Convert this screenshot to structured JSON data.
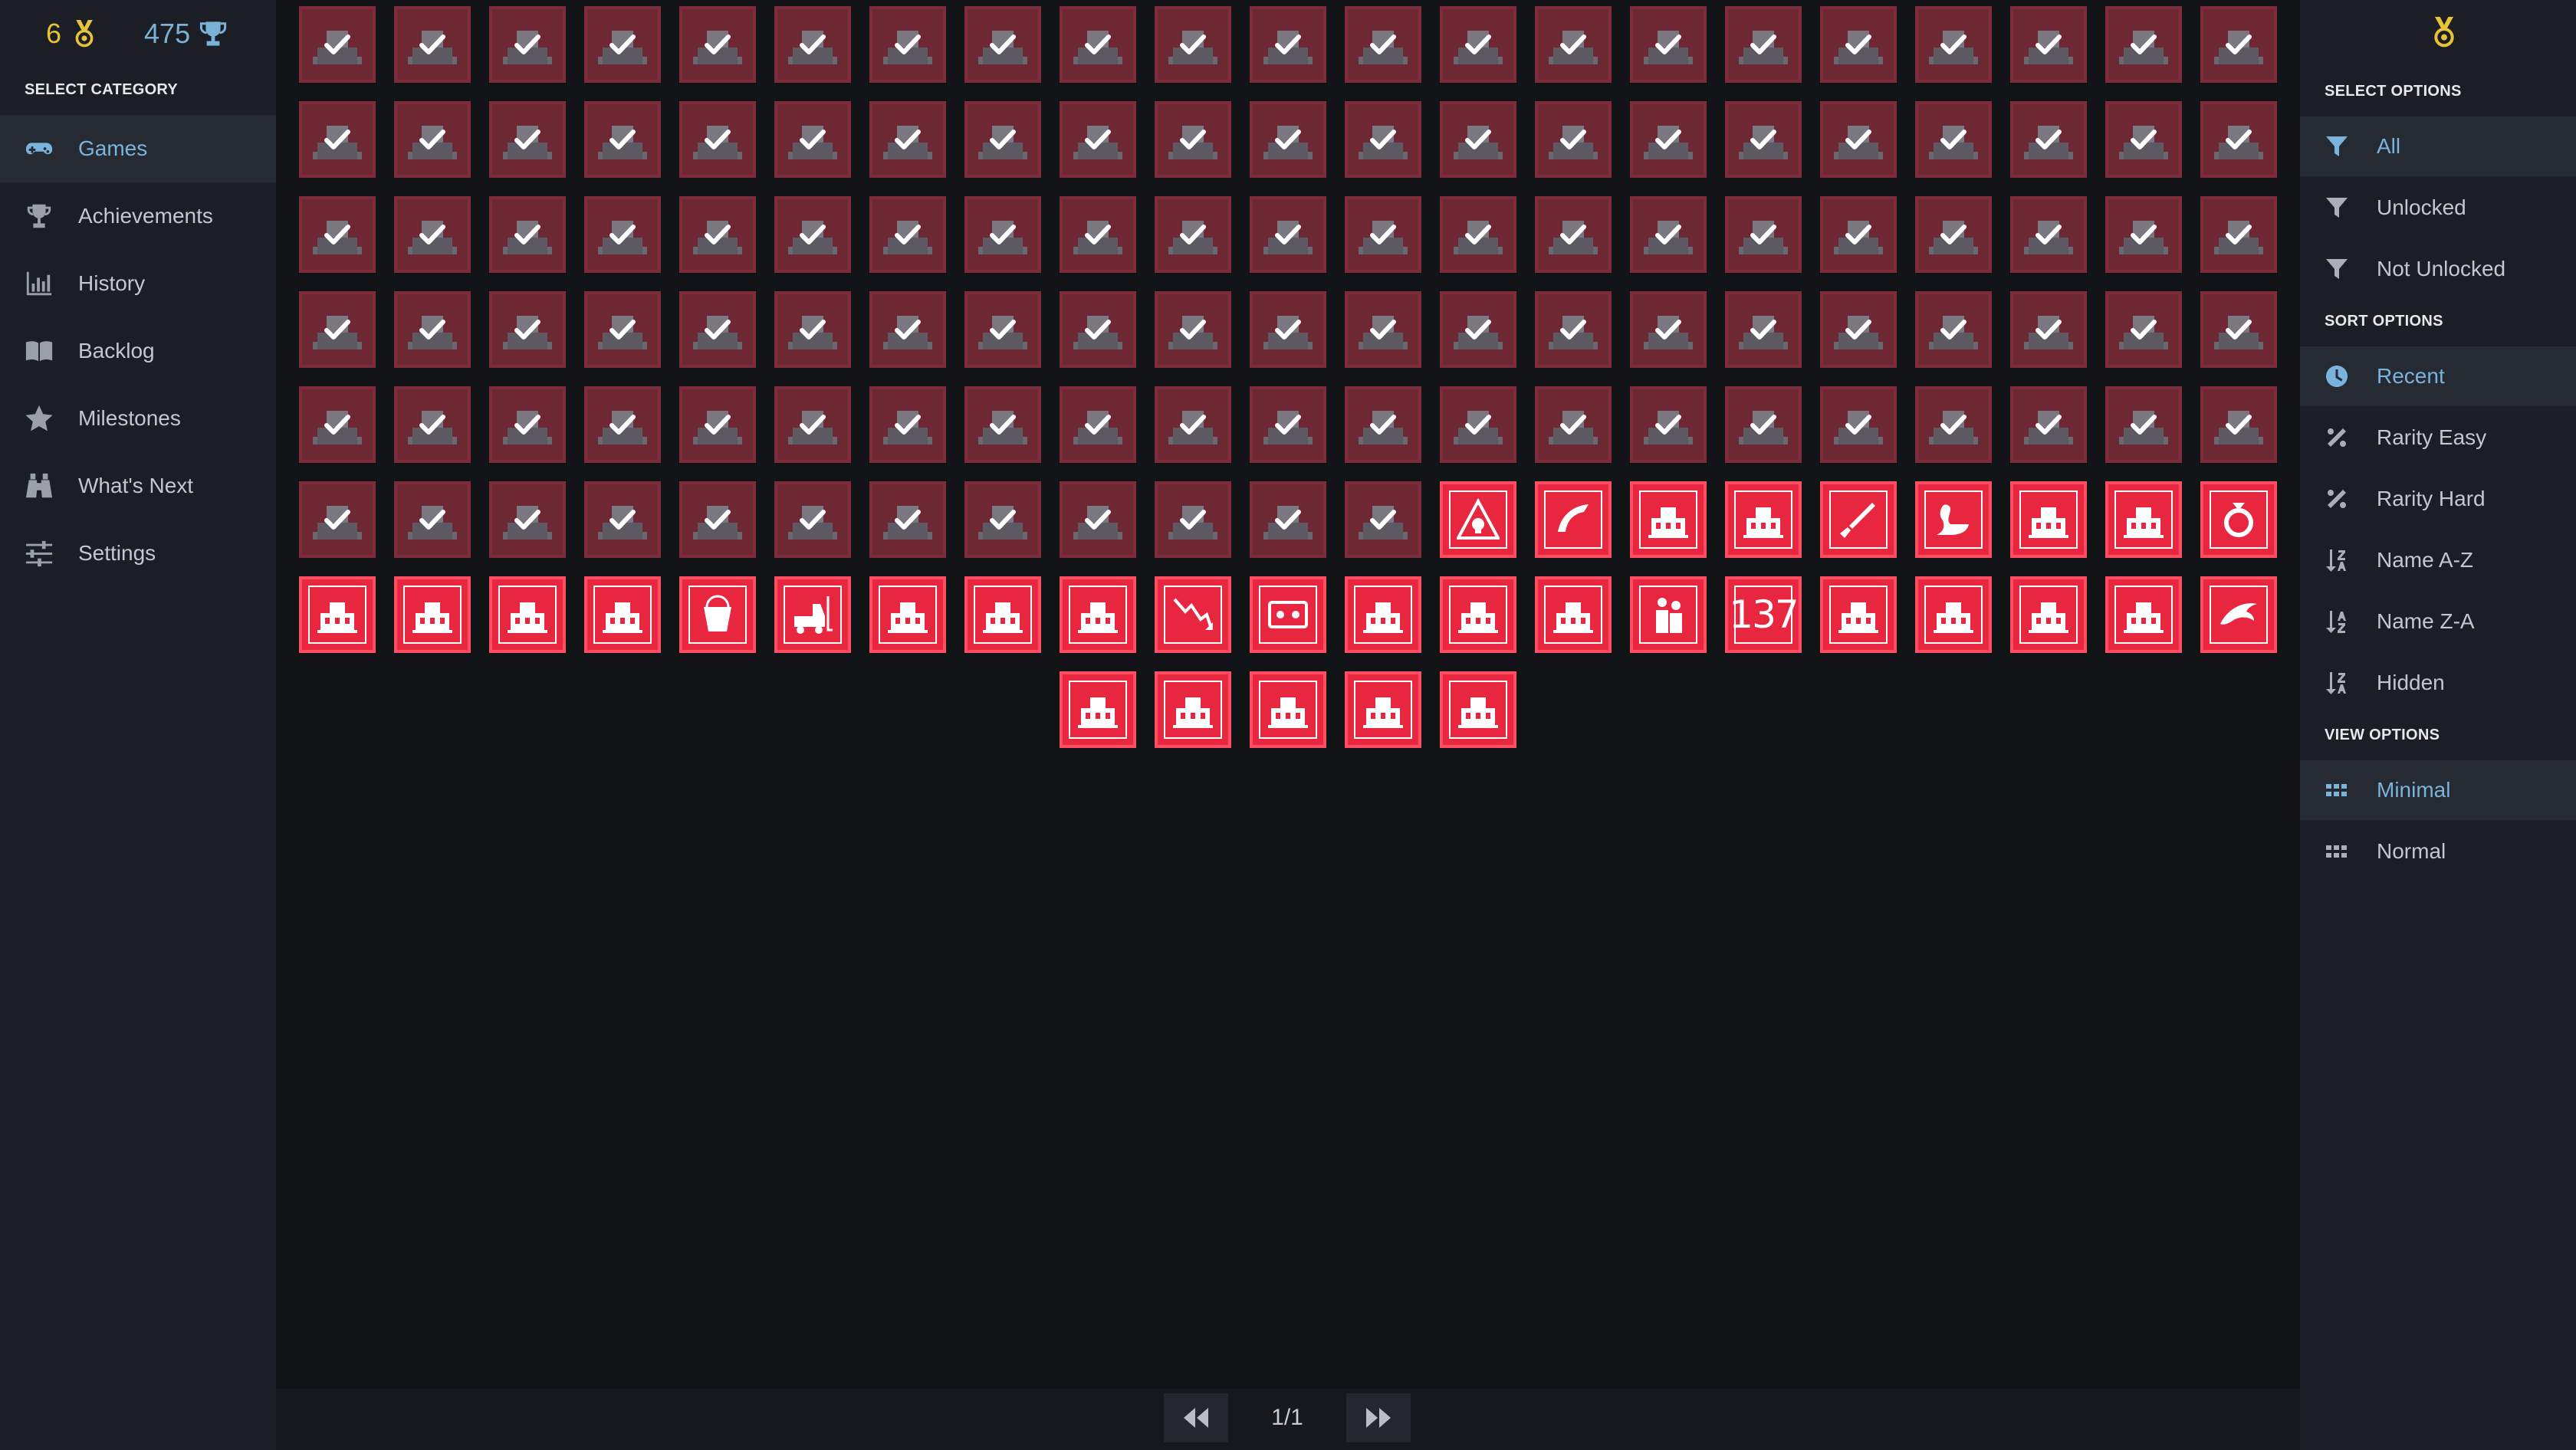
{
  "stats": {
    "medals": "6",
    "trophies": "475"
  },
  "left": {
    "section_label": "SELECT CATEGORY",
    "items": [
      {
        "label": "Games",
        "icon": "gamepad-icon",
        "active": true
      },
      {
        "label": "Achievements",
        "icon": "trophy-icon"
      },
      {
        "label": "History",
        "icon": "bar-chart-icon"
      },
      {
        "label": "Backlog",
        "icon": "book-icon"
      },
      {
        "label": "Milestones",
        "icon": "star-icon"
      },
      {
        "label": "What's Next",
        "icon": "binoculars-icon"
      },
      {
        "label": "Settings",
        "icon": "sliders-icon"
      }
    ]
  },
  "grid": {
    "unlocked_count": 117,
    "locked_tiles": [
      "warning-skull-icon",
      "arc-icon",
      "truck-icon",
      "hotel-icon",
      "paddle-icon",
      "swan-icon",
      "stars-building-icon",
      "train-icon",
      "ring-icon",
      "trophy-building-icon",
      "person-circle-icon",
      "tank-icon",
      "stars-hotel-icon",
      "bucket-icon",
      "forklift-icon",
      "house-icon",
      "house-icon",
      "trophy-house-icon",
      "falling-chart-icon",
      "cassette-icon",
      "stadium-icon",
      "trophy-stadium-icon",
      "stars-house-icon",
      "people-icon",
      "137",
      "village-icon",
      "castle-icon",
      "castle-icon",
      "trophy-castle-icon",
      "dolphin-icon",
      "ship-icon",
      "villa-icon",
      "villa-icon",
      "exit-house-icon",
      "trophy-villa-icon"
    ]
  },
  "pager": {
    "text": "1/1"
  },
  "right": {
    "select_label": "SELECT OPTIONS",
    "select": [
      {
        "label": "All",
        "icon": "filter-icon",
        "active": true
      },
      {
        "label": "Unlocked",
        "icon": "filter-icon"
      },
      {
        "label": "Not Unlocked",
        "icon": "filter-icon"
      }
    ],
    "sort_label": "SORT OPTIONS",
    "sort": [
      {
        "label": "Recent",
        "icon": "clock-icon",
        "active": true
      },
      {
        "label": "Rarity Easy",
        "icon": "percent-icon"
      },
      {
        "label": "Rarity Hard",
        "icon": "percent-icon"
      },
      {
        "label": "Name A-Z",
        "icon": "sort-az-icon"
      },
      {
        "label": "Name Z-A",
        "icon": "sort-za-icon"
      },
      {
        "label": "Hidden",
        "icon": "sort-hidden-icon"
      }
    ],
    "view_label": "VIEW OPTIONS",
    "view": [
      {
        "label": "Minimal",
        "icon": "grid-icon",
        "active": true
      },
      {
        "label": "Normal",
        "icon": "grid-icon"
      }
    ]
  },
  "colors": {
    "accent": "#7ab3dc",
    "medal": "#e8c33a",
    "locked_tile": "#e8263f",
    "unlocked_tile": "#6e2834"
  }
}
